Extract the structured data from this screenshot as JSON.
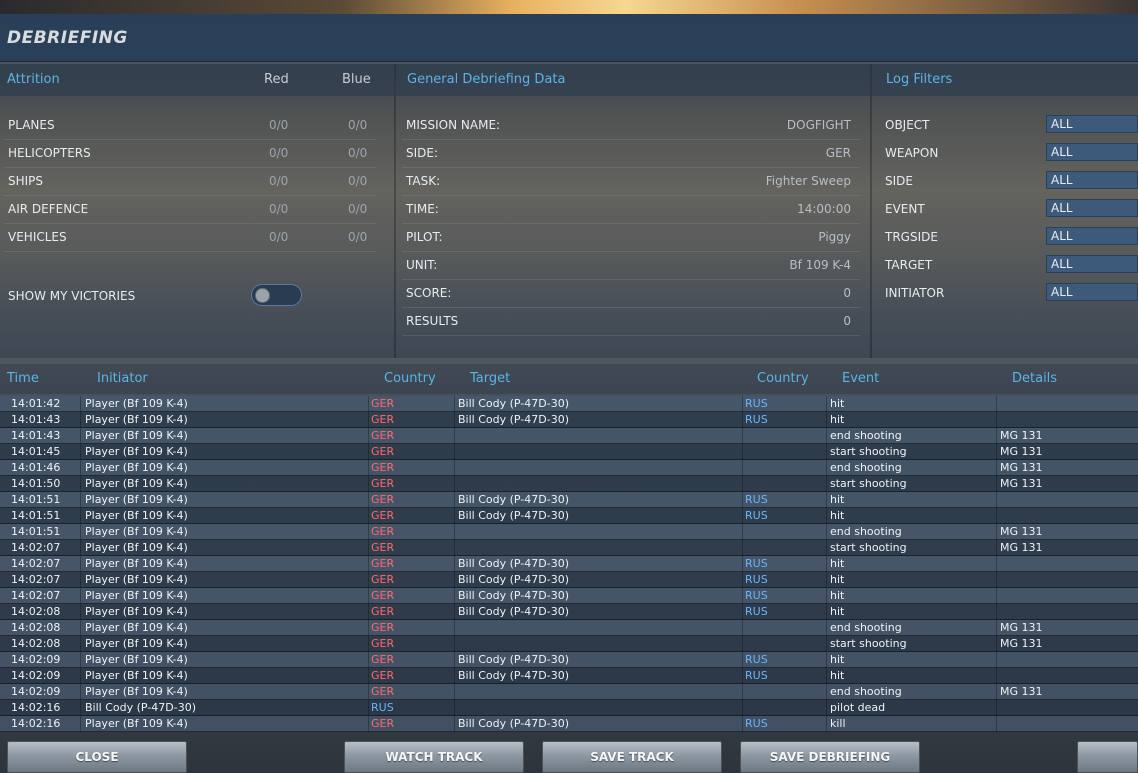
{
  "title": "DEBRIEFING",
  "attrition": {
    "header": "Attrition",
    "col_red": "Red",
    "col_blue": "Blue",
    "rows": [
      {
        "label": "PLANES",
        "red": "0/0",
        "blue": "0/0"
      },
      {
        "label": "HELICOPTERS",
        "red": "0/0",
        "blue": "0/0"
      },
      {
        "label": "SHIPS",
        "red": "0/0",
        "blue": "0/0"
      },
      {
        "label": "AIR DEFENCE",
        "red": "0/0",
        "blue": "0/0"
      },
      {
        "label": "VEHICLES",
        "red": "0/0",
        "blue": "0/0"
      }
    ],
    "show_my_victories": "SHOW MY VICTORIES",
    "toggle_state": "off"
  },
  "general": {
    "header": "General Debriefing Data",
    "rows": [
      {
        "label": "MISSION NAME:",
        "value": "DOGFIGHT"
      },
      {
        "label": "SIDE:",
        "value": "GER"
      },
      {
        "label": "TASK:",
        "value": "Fighter Sweep"
      },
      {
        "label": "TIME:",
        "value": "14:00:00"
      },
      {
        "label": "PILOT:",
        "value": "Piggy"
      },
      {
        "label": "UNIT:",
        "value": "Bf 109 K-4"
      },
      {
        "label": "SCORE:",
        "value": "0"
      },
      {
        "label": "RESULTS",
        "value": "0"
      }
    ]
  },
  "filters": {
    "header": "Log Filters",
    "rows": [
      {
        "label": "OBJECT",
        "value": "ALL"
      },
      {
        "label": "WEAPON",
        "value": "ALL"
      },
      {
        "label": "SIDE",
        "value": "ALL"
      },
      {
        "label": "EVENT",
        "value": "ALL"
      },
      {
        "label": "TRGSIDE",
        "value": "ALL"
      },
      {
        "label": "TARGET",
        "value": "ALL"
      },
      {
        "label": "INITIATOR",
        "value": "ALL"
      }
    ]
  },
  "log": {
    "columns": {
      "time": "Time",
      "initiator": "Initiator",
      "country": "Country",
      "target": "Target",
      "target_country": "Country",
      "event": "Event",
      "details": "Details"
    },
    "rows": [
      {
        "time": "14:01:42",
        "initiator": "Player (Bf 109 K-4)",
        "ic": "GER",
        "target": "Bill Cody (P-47D-30)",
        "tc": "RUS",
        "event": "hit",
        "details": ""
      },
      {
        "time": "14:01:43",
        "initiator": "Player (Bf 109 K-4)",
        "ic": "GER",
        "target": "Bill Cody (P-47D-30)",
        "tc": "RUS",
        "event": "hit",
        "details": ""
      },
      {
        "time": "14:01:43",
        "initiator": "Player (Bf 109 K-4)",
        "ic": "GER",
        "target": "",
        "tc": "",
        "event": "end shooting",
        "details": "MG 131"
      },
      {
        "time": "14:01:45",
        "initiator": "Player (Bf 109 K-4)",
        "ic": "GER",
        "target": "",
        "tc": "",
        "event": "start shooting",
        "details": "MG 131"
      },
      {
        "time": "14:01:46",
        "initiator": "Player (Bf 109 K-4)",
        "ic": "GER",
        "target": "",
        "tc": "",
        "event": "end shooting",
        "details": "MG 131"
      },
      {
        "time": "14:01:50",
        "initiator": "Player (Bf 109 K-4)",
        "ic": "GER",
        "target": "",
        "tc": "",
        "event": "start shooting",
        "details": "MG 131"
      },
      {
        "time": "14:01:51",
        "initiator": "Player (Bf 109 K-4)",
        "ic": "GER",
        "target": "Bill Cody (P-47D-30)",
        "tc": "RUS",
        "event": "hit",
        "details": ""
      },
      {
        "time": "14:01:51",
        "initiator": "Player (Bf 109 K-4)",
        "ic": "GER",
        "target": "Bill Cody (P-47D-30)",
        "tc": "RUS",
        "event": "hit",
        "details": ""
      },
      {
        "time": "14:01:51",
        "initiator": "Player (Bf 109 K-4)",
        "ic": "GER",
        "target": "",
        "tc": "",
        "event": "end shooting",
        "details": "MG 131"
      },
      {
        "time": "14:02:07",
        "initiator": "Player (Bf 109 K-4)",
        "ic": "GER",
        "target": "",
        "tc": "",
        "event": "start shooting",
        "details": "MG 131"
      },
      {
        "time": "14:02:07",
        "initiator": "Player (Bf 109 K-4)",
        "ic": "GER",
        "target": "Bill Cody (P-47D-30)",
        "tc": "RUS",
        "event": "hit",
        "details": ""
      },
      {
        "time": "14:02:07",
        "initiator": "Player (Bf 109 K-4)",
        "ic": "GER",
        "target": "Bill Cody (P-47D-30)",
        "tc": "RUS",
        "event": "hit",
        "details": ""
      },
      {
        "time": "14:02:07",
        "initiator": "Player (Bf 109 K-4)",
        "ic": "GER",
        "target": "Bill Cody (P-47D-30)",
        "tc": "RUS",
        "event": "hit",
        "details": ""
      },
      {
        "time": "14:02:08",
        "initiator": "Player (Bf 109 K-4)",
        "ic": "GER",
        "target": "Bill Cody (P-47D-30)",
        "tc": "RUS",
        "event": "hit",
        "details": ""
      },
      {
        "time": "14:02:08",
        "initiator": "Player (Bf 109 K-4)",
        "ic": "GER",
        "target": "",
        "tc": "",
        "event": "end shooting",
        "details": "MG 131"
      },
      {
        "time": "14:02:08",
        "initiator": "Player (Bf 109 K-4)",
        "ic": "GER",
        "target": "",
        "tc": "",
        "event": "start shooting",
        "details": "MG 131"
      },
      {
        "time": "14:02:09",
        "initiator": "Player (Bf 109 K-4)",
        "ic": "GER",
        "target": "Bill Cody (P-47D-30)",
        "tc": "RUS",
        "event": "hit",
        "details": ""
      },
      {
        "time": "14:02:09",
        "initiator": "Player (Bf 109 K-4)",
        "ic": "GER",
        "target": "Bill Cody (P-47D-30)",
        "tc": "RUS",
        "event": "hit",
        "details": ""
      },
      {
        "time": "14:02:09",
        "initiator": "Player (Bf 109 K-4)",
        "ic": "GER",
        "target": "",
        "tc": "",
        "event": "end shooting",
        "details": "MG 131"
      },
      {
        "time": "14:02:16",
        "initiator": "Bill Cody (P-47D-30)",
        "ic": "RUS",
        "target": "",
        "tc": "",
        "event": "pilot dead",
        "details": ""
      },
      {
        "time": "14:02:16",
        "initiator": "Player (Bf 109 K-4)",
        "ic": "GER",
        "target": "Bill Cody (P-47D-30)",
        "tc": "RUS",
        "event": "kill",
        "details": ""
      }
    ]
  },
  "buttons": {
    "close": "CLOSE",
    "watch_track": "WATCH TRACK",
    "save_track": "SAVE TRACK",
    "save_debriefing": "SAVE DEBRIEFING"
  },
  "colors": {
    "accent_blue": "#5bb4e6",
    "ger": "#ff6a6a",
    "rus": "#6ab4ff"
  }
}
